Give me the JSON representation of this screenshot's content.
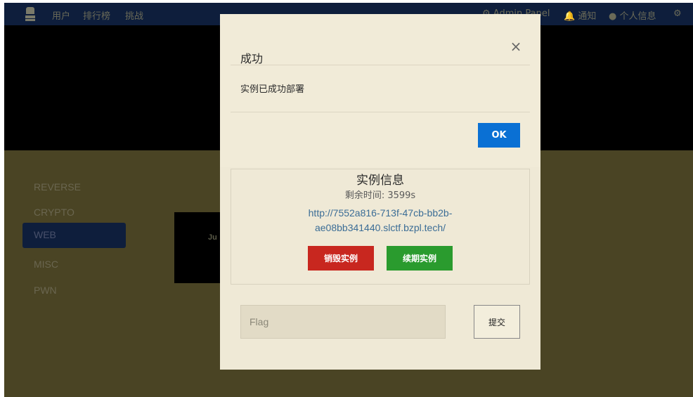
{
  "navbar": {
    "links": [
      "用户",
      "排行榜",
      "挑战"
    ],
    "right": [
      "Admin Panel",
      "通知",
      "个人信息"
    ]
  },
  "sidebar": {
    "items": [
      "REVERSE",
      "CRYPTO",
      "WEB",
      "MISC",
      "PWN"
    ],
    "active": "WEB"
  },
  "background_card": {
    "text": "Ju"
  },
  "challenge_modal": {
    "info_title": "实例信息",
    "remaining": "剩余时间: 3599s",
    "url_line1": "http://7552a816-713f-47cb-bb2b-",
    "url_line2": "ae08bb341440.slctf.bzpl.tech/",
    "destroy_label": "销毁实例",
    "renew_label": "续期实例",
    "flag_placeholder": "Flag",
    "submit_label": "提交",
    "colors": {
      "destroy": "#c8271f",
      "renew": "#2a9b2e"
    }
  },
  "success_dialog": {
    "title": "成功",
    "close_icon": "close-icon",
    "message": "实例已成功部署",
    "ok_label": "OK",
    "ok_color": "#0a70d4"
  }
}
